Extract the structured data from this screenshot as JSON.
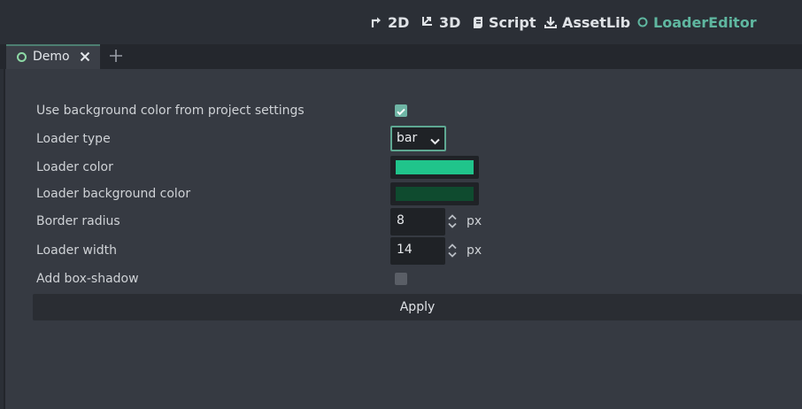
{
  "workspace_tabs": [
    {
      "label": "2D",
      "icon": "2d-arrow-icon",
      "active": false
    },
    {
      "label": "3D",
      "icon": "3d-axis-icon",
      "active": false
    },
    {
      "label": "Script",
      "icon": "script-icon",
      "active": false
    },
    {
      "label": "AssetLib",
      "icon": "download-icon",
      "active": false
    },
    {
      "label": "LoaderEditor",
      "icon": "loader-circle-icon",
      "active": true
    }
  ],
  "scene_tab": {
    "label": "Demo",
    "icon": "scene-circle-icon"
  },
  "settings": {
    "use_bg_label": "Use background color from project settings",
    "use_bg_checked": true,
    "loader_type_label": "Loader type",
    "loader_type_value": "bar",
    "loader_color_label": "Loader color",
    "loader_color_value": "#20c48b",
    "loader_bg_color_label": "Loader background color",
    "loader_bg_color_value": "#0f4b2f",
    "border_radius_label": "Border radius",
    "border_radius_value": "8",
    "border_radius_unit": "px",
    "loader_width_label": "Loader width",
    "loader_width_value": "14",
    "loader_width_unit": "px",
    "shadow_label": "Add box-shadow",
    "shadow_checked": false
  },
  "apply_label": "Apply",
  "colors": {
    "accent": "#5fb7a0",
    "background": "#363a42",
    "topbar": "#2b2f36"
  }
}
